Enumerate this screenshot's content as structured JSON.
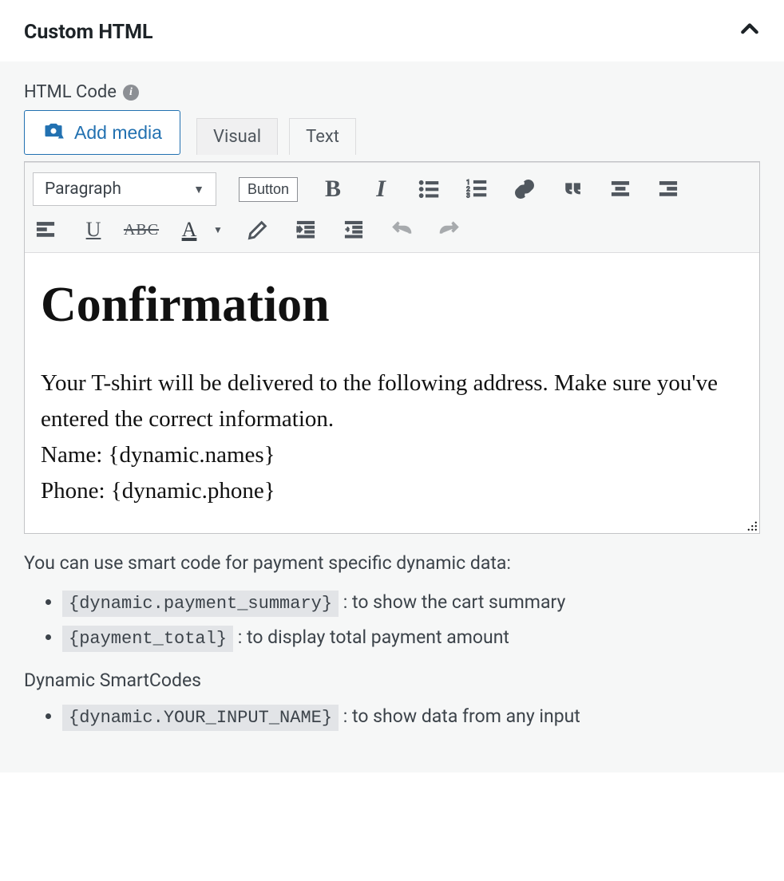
{
  "header": {
    "title": "Custom HTML"
  },
  "field": {
    "label": "HTML Code"
  },
  "buttons": {
    "add_media": "Add media",
    "button_label": "Button"
  },
  "tabs": {
    "visual": "Visual",
    "text": "Text"
  },
  "format_select": {
    "value": "Paragraph"
  },
  "content": {
    "heading": "Confirmation",
    "body_line1": "Your T-shirt will be delivered to the following address. Make sure you've entered the correct information.",
    "body_line2": "Name: {dynamic.names}",
    "body_line3": "Phone: {dynamic.phone}"
  },
  "help": {
    "intro": "You can use smart code for payment specific dynamic data:",
    "items": [
      {
        "code": "{dynamic.payment_summary}",
        "desc": ": to show the cart summary"
      },
      {
        "code": "{payment_total}",
        "desc": ": to display total payment amount"
      }
    ],
    "dynamic_heading": "Dynamic SmartCodes",
    "dynamic_items": [
      {
        "code": "{dynamic.YOUR_INPUT_NAME}",
        "desc": ": to show data from any input"
      }
    ]
  }
}
